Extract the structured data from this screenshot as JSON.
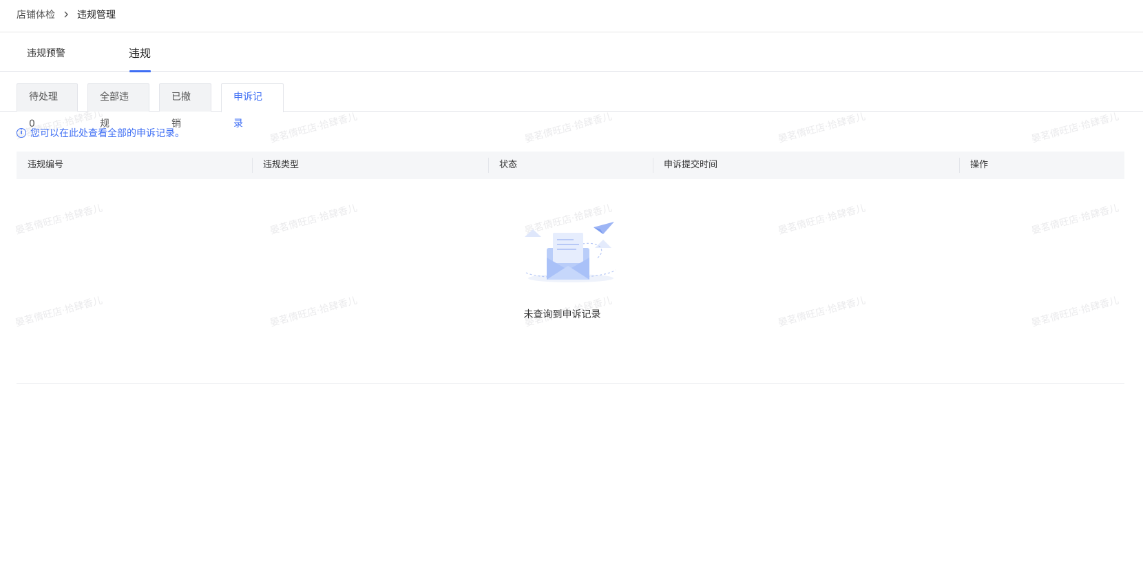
{
  "breadcrumb": {
    "parent": "店铺体检",
    "current": "违规管理"
  },
  "main_tabs": [
    {
      "label": "违规预警",
      "active": false
    },
    {
      "label": "违规",
      "active": true
    }
  ],
  "sub_tabs": [
    {
      "label": "待处理 0",
      "active": false
    },
    {
      "label": "全部违规",
      "active": false
    },
    {
      "label": "已撤销",
      "active": false
    },
    {
      "label": "申诉记录",
      "active": true
    }
  ],
  "info_tip": "您可以在此处查看全部的申诉记录。",
  "table": {
    "columns": [
      "违规编号",
      "违规类型",
      "状态",
      "申诉提交时间",
      "操作"
    ],
    "rows": [],
    "empty_text": "未查询到申诉记录"
  },
  "watermark": "晏茗倩旺店·拾肆香儿",
  "colors": {
    "accent": "#3e6ef4",
    "header_bg": "#f5f6f8",
    "tab_bg": "#f2f3f5",
    "border": "#e3e5ea"
  },
  "icons": {
    "breadcrumb_separator": "chevron-right-icon",
    "info": "info-icon",
    "empty_state": "empty-mail-illustration"
  }
}
